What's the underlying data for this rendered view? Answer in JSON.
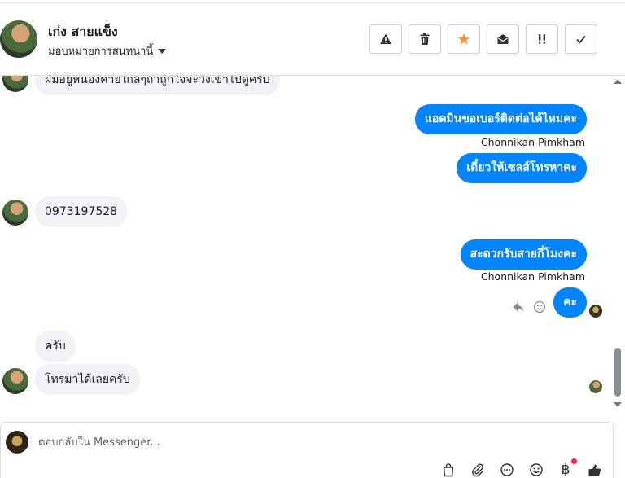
{
  "header": {
    "contact_name": "เก่ง สายแข็ง",
    "assign_label": "มอบหมายการสนทนานี้"
  },
  "toolbar": {
    "buttons": [
      {
        "name": "warning-button",
        "icon": "warning-icon"
      },
      {
        "name": "delete-button",
        "icon": "trash-icon"
      },
      {
        "name": "star-button",
        "icon": "star-icon",
        "color": "#f7923b"
      },
      {
        "name": "mark-unread-button",
        "icon": "envelope-open-icon"
      },
      {
        "name": "follow-up-button",
        "icon": "exclamation-icon"
      },
      {
        "name": "done-button",
        "icon": "check-icon"
      }
    ]
  },
  "messages": [
    {
      "direction": "in",
      "text": "ผมอยู่หนองคายใกล้ๆถ้าถูกใจจะวิ่งเข้าไปดูครับ"
    },
    {
      "direction": "out",
      "text": "แอดมินขอเบอร์ติดต่อได้ไหมคะ",
      "sender": "Chonnikan Pimkham"
    },
    {
      "direction": "out",
      "text": "เดี๋ยวให้เซลส์โทรหาคะ"
    },
    {
      "direction": "in",
      "text": "0973197528"
    },
    {
      "direction": "out",
      "text": "สะดวกรับสายกี่โมงคะ",
      "sender": "Chonnikan Pimkham"
    },
    {
      "direction": "out",
      "text": "คะ"
    },
    {
      "direction": "in",
      "text": "ครับ"
    },
    {
      "direction": "in",
      "text": "โทรมาได้เลยครับ"
    }
  ],
  "composer": {
    "placeholder": "ตอบกลับใน Messenger..."
  },
  "colors": {
    "outgoing_bubble": "#0084ff",
    "incoming_bubble": "#f0f2f5",
    "star": "#f7923b",
    "notification_dot": "#f0284a"
  }
}
